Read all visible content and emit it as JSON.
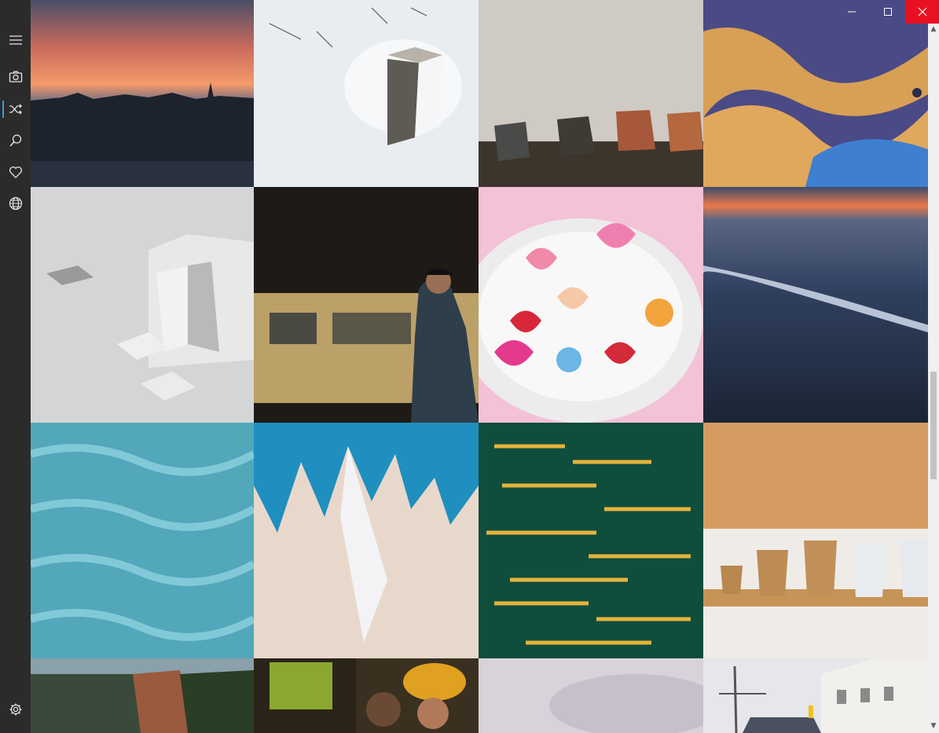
{
  "window": {
    "controls": [
      "minimize",
      "maximize",
      "close"
    ],
    "close_color": "#e81123"
  },
  "sidebar": {
    "items": [
      {
        "icon": "hamburger-menu-icon",
        "active": false
      },
      {
        "icon": "camera-icon",
        "active": false
      },
      {
        "icon": "shuffle-icon",
        "active": true
      },
      {
        "icon": "search-icon",
        "active": false
      },
      {
        "icon": "heart-icon",
        "active": false
      },
      {
        "icon": "globe-icon",
        "active": false
      }
    ],
    "footer_icon": "settings-icon",
    "accent": "#3a9ad9"
  },
  "gallery": {
    "columns": 4,
    "tiles": [
      {
        "subject": "sunset-city-skyline"
      },
      {
        "subject": "snowy-aerial-structure"
      },
      {
        "subject": "beach-chairs-sunset"
      },
      {
        "subject": "abstract-blue-orange-swirl"
      },
      {
        "subject": "white-3d-letters"
      },
      {
        "subject": "man-with-camera-subway"
      },
      {
        "subject": "candy-hearts-bowl"
      },
      {
        "subject": "ocean-wave-long-exposure"
      },
      {
        "subject": "turquoise-water-texture"
      },
      {
        "subject": "blue-white-paint-abstract"
      },
      {
        "subject": "golden-light-streaks"
      },
      {
        "subject": "coffee-cups-percent"
      },
      {
        "subject": "cliff-forest-landscape"
      },
      {
        "subject": "men-with-sombrero"
      },
      {
        "subject": "cloudy-sky"
      },
      {
        "subject": "city-building-flags"
      }
    ]
  },
  "scrollbar": {
    "position": 0.49
  }
}
